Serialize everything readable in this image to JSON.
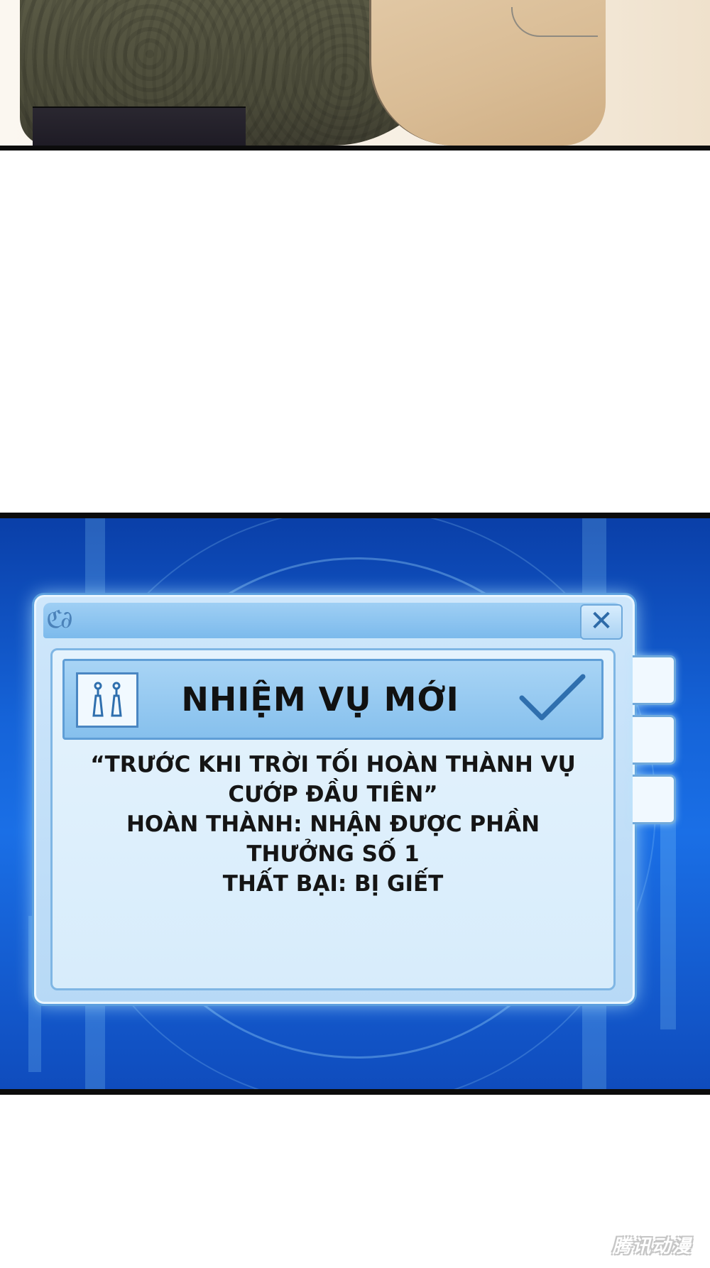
{
  "dialog": {
    "title": "NHIỆM VỤ MỚI",
    "close_glyph": "✕",
    "ornament_glyph": "ℭ∂",
    "quest_lines": [
      "“TRƯỚC KHI TRỜI TỐI HOÀN THÀNH VỤ",
      "CƯỚP ĐẦU TIÊN”",
      "HOÀN THÀNH: NHẬN ĐƯỢC PHẦN",
      "THƯỞNG SỐ 1",
      "THẤT BẠI: BỊ GIẾT"
    ],
    "icons": {
      "quest": "earrings-icon",
      "confirm": "checkmark-icon",
      "close": "close-icon"
    },
    "side_tab_count": 3
  },
  "watermark": {
    "text": "腾讯动漫"
  },
  "colors": {
    "panel_blue": "#1563d8",
    "window_light": "#cfe7fb",
    "border_blue": "#5b9fde",
    "text_dark": "#111111"
  }
}
